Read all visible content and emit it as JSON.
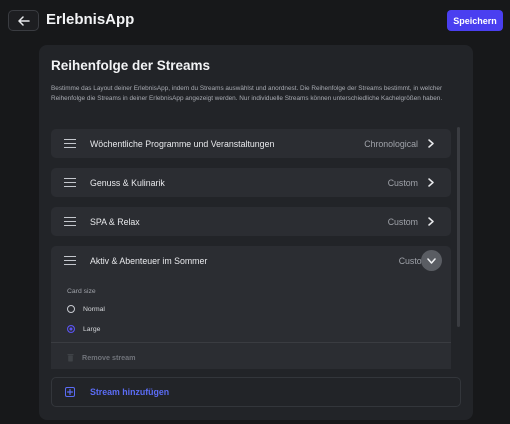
{
  "header": {
    "app_title": "ErlebnisApp",
    "save_label": "Speichern",
    "back_icon": "arrow-left-icon"
  },
  "section": {
    "title": "Reihenfolge der Streams",
    "description": "Bestimme das Layout deiner ErlebnisApp, indem du Streams auswählst und anordnest. Die Reihenfolge der Streams bestimmt, in welcher Reihenfolge die Streams in deiner ErlebnisApp angezeigt werden. Nur individuelle Streams können unterschiedliche Kachelgrößen haben."
  },
  "streams": [
    {
      "name": "Wöchentliche Programme und Veranstaltungen",
      "mode": "Chronological",
      "expanded": false
    },
    {
      "name": "Genuss & Kulinarik",
      "mode": "Custom",
      "expanded": false
    },
    {
      "name": "SPA & Relax",
      "mode": "Custom",
      "expanded": false
    },
    {
      "name": "Aktiv & Abenteuer im Sommer",
      "mode": "Custom",
      "expanded": true
    }
  ],
  "expanded_panel": {
    "card_size_label": "Card size",
    "options": [
      {
        "label": "Normal",
        "selected": false
      },
      {
        "label": "Large",
        "selected": true
      }
    ],
    "remove_label": "Remove stream"
  },
  "add_stream_label": "Stream hinzufügen",
  "colors": {
    "accent": "#4a3ff0",
    "link": "#5b6cf5",
    "background": "#17181a",
    "card": "#222428",
    "row": "#2b2d32"
  }
}
